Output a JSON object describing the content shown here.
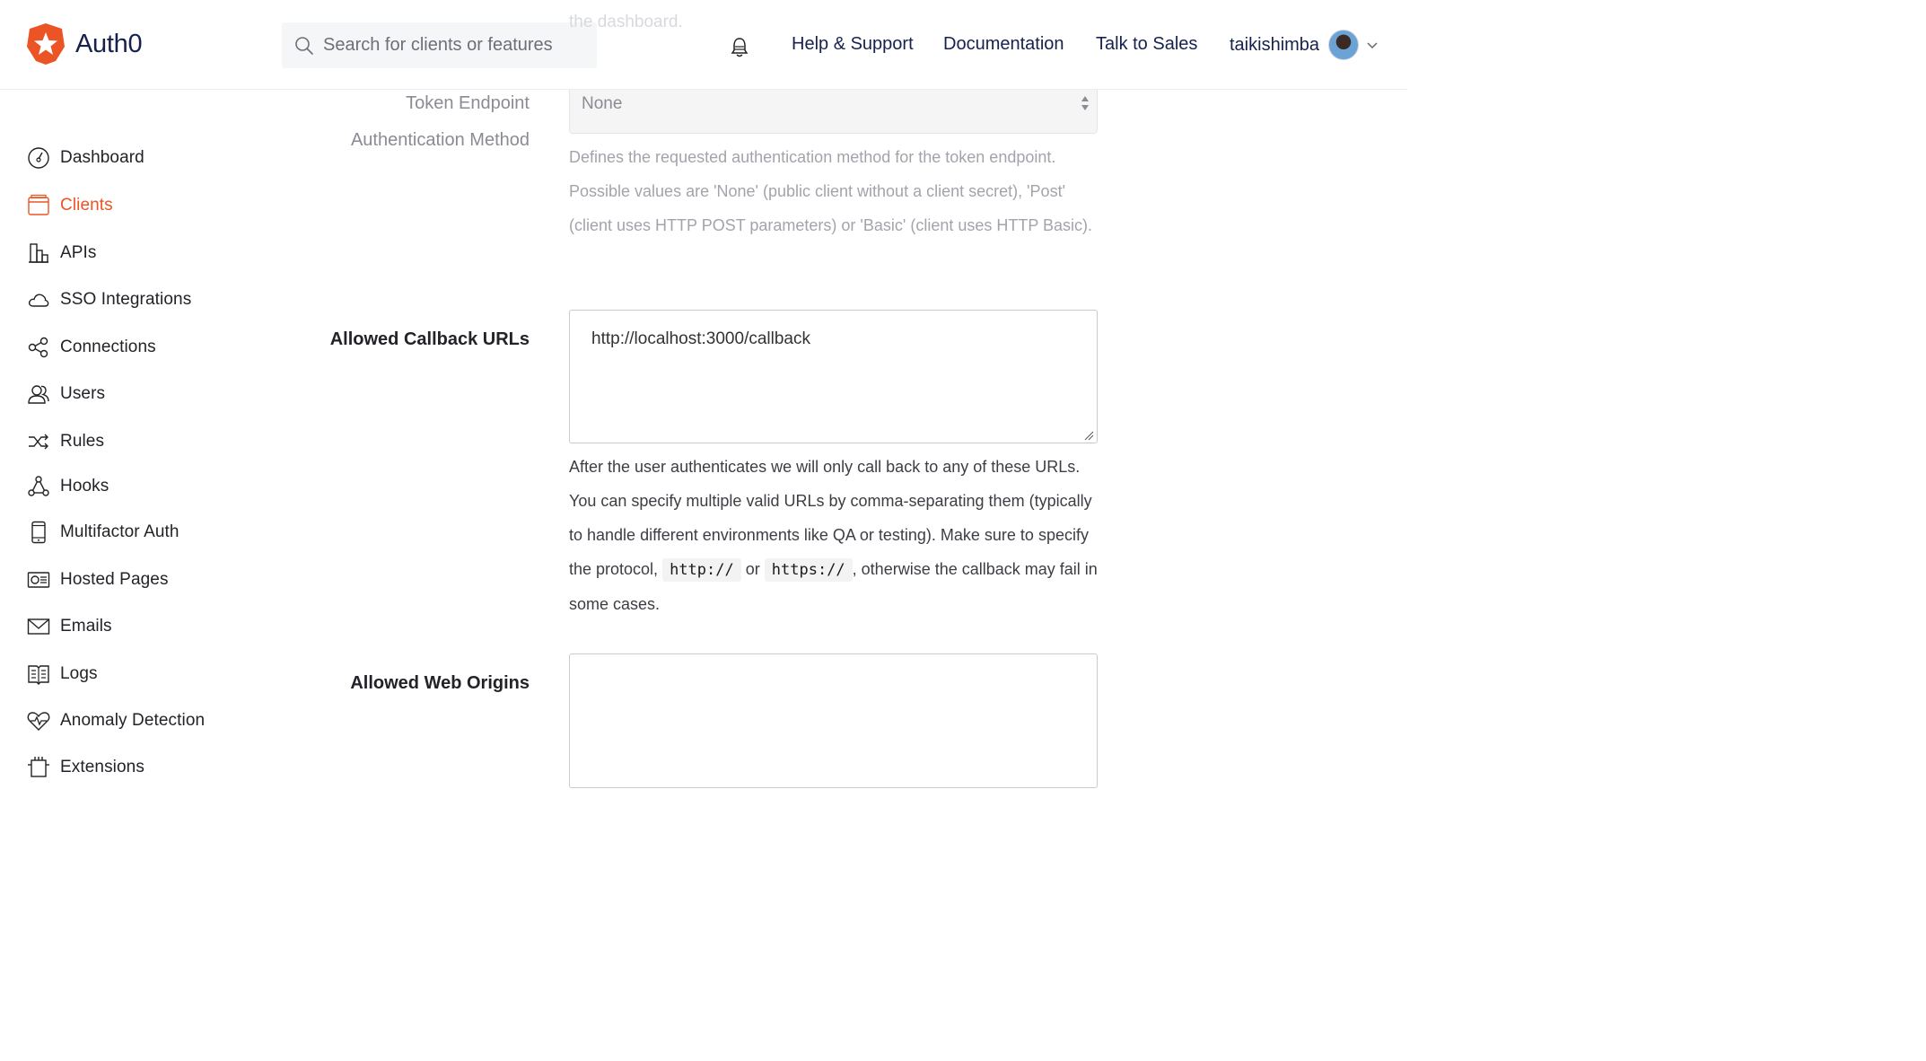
{
  "header": {
    "brand": "Auth0",
    "search_placeholder": "Search for clients or features",
    "links": [
      "Help & Support",
      "Documentation",
      "Talk to Sales"
    ],
    "username": "taikishimba",
    "faded_text": "the dashboard."
  },
  "sidebar": {
    "items": [
      {
        "label": "Dashboard",
        "icon": "dashboard-icon",
        "active": false
      },
      {
        "label": "Clients",
        "icon": "clients-icon",
        "active": true
      },
      {
        "label": "APIs",
        "icon": "apis-icon",
        "active": false
      },
      {
        "label": "SSO Integrations",
        "icon": "cloud-icon",
        "active": false
      },
      {
        "label": "Connections",
        "icon": "connections-icon",
        "active": false
      },
      {
        "label": "Users",
        "icon": "users-icon",
        "active": false
      },
      {
        "label": "Rules",
        "icon": "shuffle-icon",
        "active": false
      },
      {
        "label": "Hooks",
        "icon": "hooks-icon",
        "active": false
      },
      {
        "label": "Multifactor Auth",
        "icon": "phone-icon",
        "active": false
      },
      {
        "label": "Hosted Pages",
        "icon": "hosted-pages-icon",
        "active": false
      },
      {
        "label": "Emails",
        "icon": "envelope-icon",
        "active": false
      },
      {
        "label": "Logs",
        "icon": "book-icon",
        "active": false
      },
      {
        "label": "Anomaly Detection",
        "icon": "heart-pulse-icon",
        "active": false
      },
      {
        "label": "Extensions",
        "icon": "chip-icon",
        "active": false
      }
    ]
  },
  "form": {
    "token_label_line1": "Token Endpoint",
    "token_label_line2": "Authentication Method",
    "token_value": "None",
    "token_help": "Defines the requested authentication method for the token endpoint. Possible values are 'None' (public client without a client secret), 'Post' (client uses HTTP POST parameters) or 'Basic' (client uses HTTP Basic).",
    "callback_label": "Allowed Callback URLs",
    "callback_value": "http://localhost:3000/callback",
    "callback_help_before": "After the user authenticates we will only call back to any of these URLs. You can specify multiple valid URLs by comma-separating them (typically to handle different environments like QA or testing). Make sure to specify the protocol,",
    "callback_help_code1": "http://",
    "callback_help_or": "or",
    "callback_help_code2": "https://",
    "callback_help_after": ", otherwise the callback may fail in some cases.",
    "origins_label": "Allowed Web Origins",
    "origins_value": ""
  },
  "colors": {
    "accent": "#eb5424",
    "brand_text": "#16214d"
  }
}
